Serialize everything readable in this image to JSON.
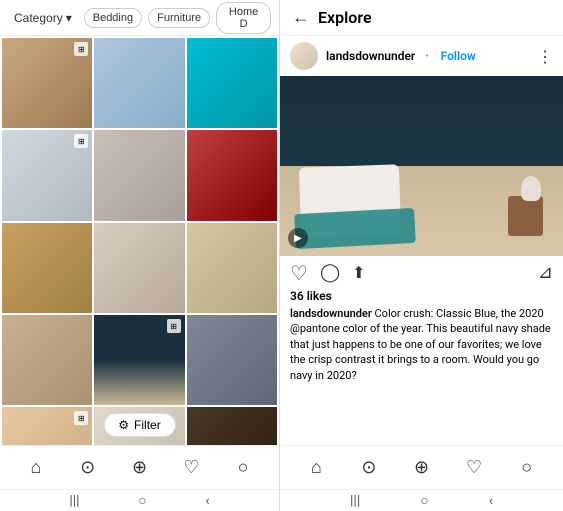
{
  "left": {
    "category_label": "Category",
    "category_arrow": "▾",
    "filter_tags": [
      "Bedding",
      "Furniture",
      "Home D"
    ],
    "filter_btn_label": "Filter",
    "filter_icon": "⚙",
    "grid_cells": [
      {
        "id": 1,
        "class": "cell-1",
        "has_overlay": true
      },
      {
        "id": 2,
        "class": "cell-2",
        "has_overlay": false
      },
      {
        "id": 3,
        "class": "cell-3",
        "has_overlay": false
      },
      {
        "id": 4,
        "class": "cell-4",
        "has_overlay": true
      },
      {
        "id": 5,
        "class": "cell-5",
        "has_overlay": false
      },
      {
        "id": 6,
        "class": "cell-6",
        "has_overlay": false
      },
      {
        "id": 7,
        "class": "cell-7",
        "has_overlay": false
      },
      {
        "id": 8,
        "class": "cell-8",
        "has_overlay": false
      },
      {
        "id": 9,
        "class": "cell-9",
        "has_overlay": false
      },
      {
        "id": 10,
        "class": "cell-10",
        "has_overlay": false
      },
      {
        "id": 11,
        "class": "cell-bedroom-dark",
        "has_overlay": true
      },
      {
        "id": 12,
        "class": "cell-12",
        "has_overlay": false
      },
      {
        "id": 13,
        "class": "cell-13",
        "has_overlay": true
      },
      {
        "id": 14,
        "class": "cell-14",
        "has_overlay": false
      },
      {
        "id": 15,
        "class": "cell-15",
        "has_overlay": false
      }
    ],
    "bottom_nav": [
      {
        "icon": "⌂",
        "name": "home"
      },
      {
        "icon": "⊙",
        "name": "search"
      },
      {
        "icon": "⊕",
        "name": "add"
      },
      {
        "icon": "♡",
        "name": "likes"
      },
      {
        "icon": "○",
        "name": "profile"
      }
    ],
    "android_nav": [
      "|||",
      "○",
      "‹"
    ]
  },
  "right": {
    "back_icon": "←",
    "title": "Explore",
    "username": "landsdownunder",
    "follow_label": "Follow",
    "dot": "•",
    "more_icon": "⋮",
    "likes_count": "36 likes",
    "caption_username": "landsdownunder",
    "caption_text": " Color crush: Classic Blue, the 2020 @pantone color of the year. This  beautiful navy shade that just happens to be one of our favorites; we love the crisp contrast it brings to a room. Would you go navy in 2020?",
    "actions": [
      {
        "icon": "♡",
        "name": "like"
      },
      {
        "icon": "○",
        "name": "comment"
      },
      {
        "icon": "⬆",
        "name": "share"
      }
    ],
    "save_icon": "⊿",
    "bottom_nav": [
      {
        "icon": "⌂",
        "name": "home"
      },
      {
        "icon": "⊙",
        "name": "search"
      },
      {
        "icon": "⊕",
        "name": "add"
      },
      {
        "icon": "♡",
        "name": "likes"
      },
      {
        "icon": "○",
        "name": "profile"
      }
    ],
    "android_nav": [
      "|||",
      "○",
      "‹"
    ]
  }
}
